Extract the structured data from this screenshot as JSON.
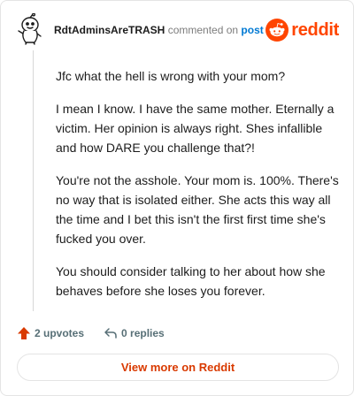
{
  "header": {
    "username": "RdtAdminsAreTRASH",
    "verb": "commented on",
    "post_link": "post",
    "brand": "reddit"
  },
  "comment": {
    "paragraphs": [
      "Jfc what the hell is wrong with your mom?",
      "I mean I know. I have the same mother. Eternally a victim. Her opinion is always right. Shes infallible and how DARE you challenge that?!",
      "You're not the asshole. Your mom is. 100%. There's no way that is isolated either. She acts this way all the time and I bet this isn't the first first time she's fucked you over.",
      "You should consider talking to her about how she behaves before she loses you forever."
    ]
  },
  "actions": {
    "upvotes": "2 upvotes",
    "replies": "0 replies"
  },
  "footer": {
    "view_more": "View more on Reddit"
  },
  "colors": {
    "brand": "#ff4500",
    "link": "#0079d3",
    "view_more": "#d93a00"
  }
}
